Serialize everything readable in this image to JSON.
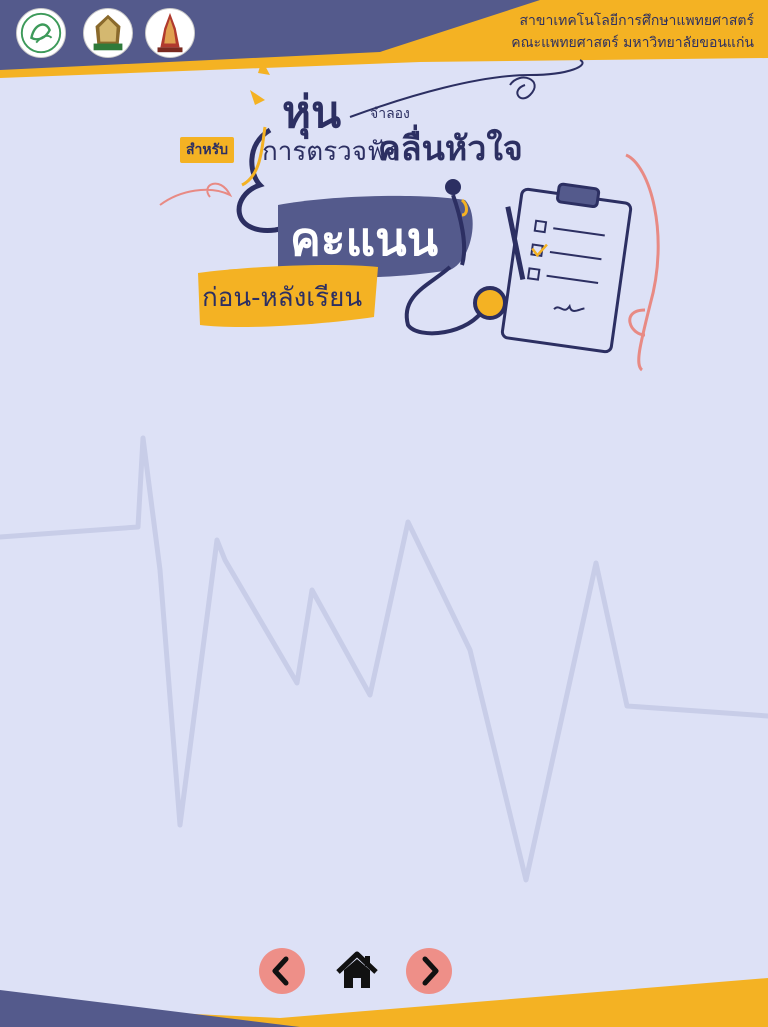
{
  "header": {
    "line1": "สาขาเทคโนโลยีการศึกษาแพทยศาสตร์",
    "line2": "คณะแพทยศาสตร์ มหาวิทยาลัยขอนแก่น",
    "logos": [
      "medical-education-logo",
      "university-emblem-logo",
      "faculty-emblem-logo"
    ]
  },
  "title": {
    "hun": "หุ่น",
    "jamlong": "จำลอง",
    "samrap": "สำหรับ",
    "kan_truat": "การตรวจฟัง",
    "khlun": "คลื่นหัวใจ",
    "score": "คะแนน",
    "pre_post": "ก่อน-หลังเรียน"
  },
  "nav": {
    "prev_icon": "chevron-left-icon",
    "home_icon": "home-icon",
    "next_icon": "chevron-right-icon"
  },
  "colors": {
    "navy": "#545a8c",
    "gold": "#f4b223",
    "background": "#dde1f6",
    "button": "#ee8f88"
  }
}
